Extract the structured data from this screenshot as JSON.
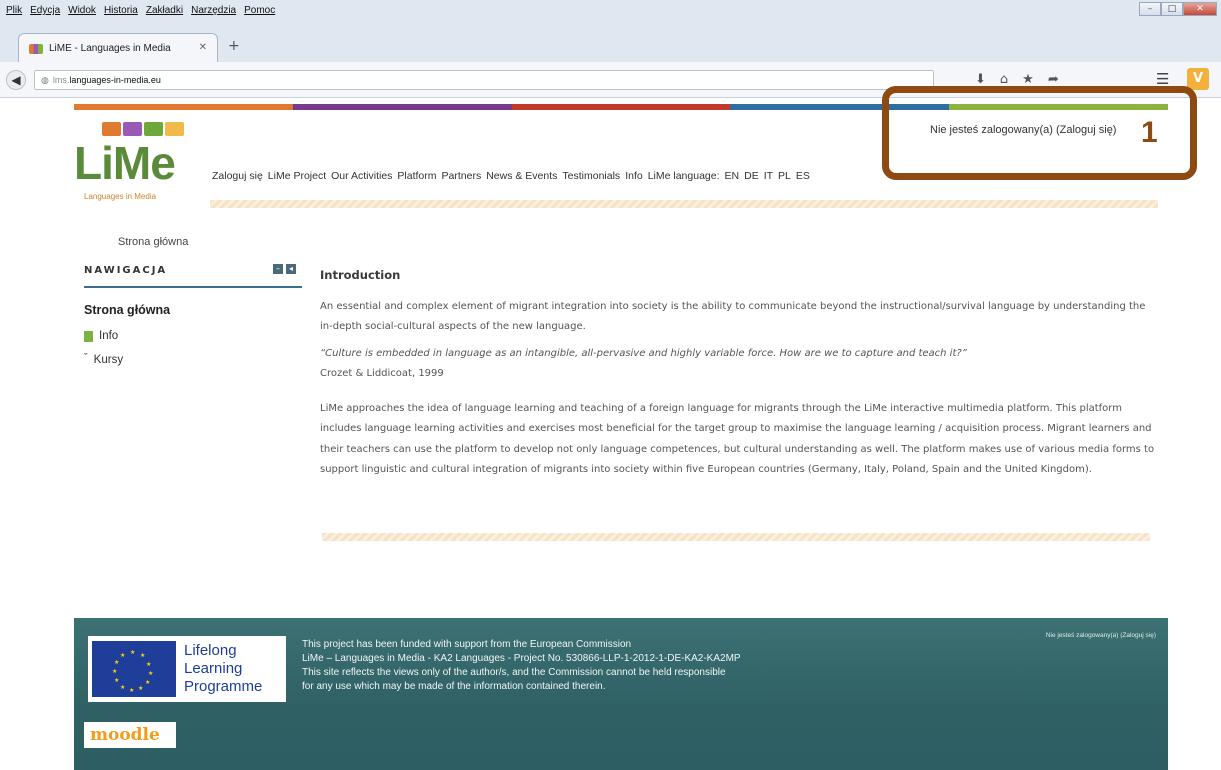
{
  "browser": {
    "menu": [
      "Plik",
      "Edycja",
      "Widok",
      "Historia",
      "Zakładki",
      "Narzędzia",
      "Pomoc"
    ],
    "tab_title": "LiME - Languages in Media",
    "url_host": "lms.",
    "url_domain": "languages-in-media.eu"
  },
  "site": {
    "logo_text": "LiMe",
    "logo_sub": "Languages in Media",
    "login_status": "Nie jesteś zalogowany(a) (Zaloguj się)",
    "topnav": [
      "Zaloguj się",
      "LiMe Project",
      "Our Activities",
      "Platform",
      "Partners",
      "News & Events",
      "Testimonials",
      "Info",
      "LiMe language:",
      "EN",
      "DE",
      "IT",
      "PL",
      "ES"
    ],
    "colors": {
      "orange": "#e07a2e",
      "purple": "#7a3a8c",
      "red": "#c0392b",
      "blue": "#2f6f9f",
      "green": "#8ab43b",
      "teal": "#2e6064"
    }
  },
  "breadcrumb": "Strona główna",
  "navigation": {
    "title": "NAWIGACJA",
    "home": "Strona główna",
    "info": "Info",
    "kursy": "Kursy"
  },
  "content": {
    "heading": "Introduction",
    "p1": "An essential and complex element of migrant integration into society is the ability to communicate beyond the instructional/survival language by understanding the in-depth social-cultural aspects of the new language.",
    "quote": "“Culture is embedded in language as an intangible, all-pervasive and highly variable force. How are we to capture and teach it?”",
    "author": "Crozet & Liddicoat, 1999",
    "p2": "LiMe approaches the idea of language learning and teaching of a foreign language for migrants through the LiMe interactive multimedia platform. This platform includes language learning activities and exercises most beneficial for the target group to maximise the language learning / acquisition process. Migrant learners and their teachers can use the platform to develop not only language competences, but cultural understanding as well. The platform makes use of various media forms to support linguistic and cultural integration of migrants into society within five European countries (Germany, Italy, Poland, Spain and the United Kingdom)."
  },
  "footer": {
    "llp": [
      "Lifelong",
      "Learning",
      "Programme"
    ],
    "lines": [
      "This project has been funded with support from the European Commission",
      "LiMe – Languages in Media - KA2 Languages - Project No. 530866-LLP-1-2012-1-DE-KA2-KA2MP",
      "This site reflects the views only of the author/s, and the Commission cannot be held responsible",
      "for any use which may be made of the information contained therein."
    ],
    "login_status": "Nie jesteś zalogowany(a) (Zaloguj się)",
    "moodle": "moodle"
  },
  "annotation": {
    "number": "1"
  }
}
